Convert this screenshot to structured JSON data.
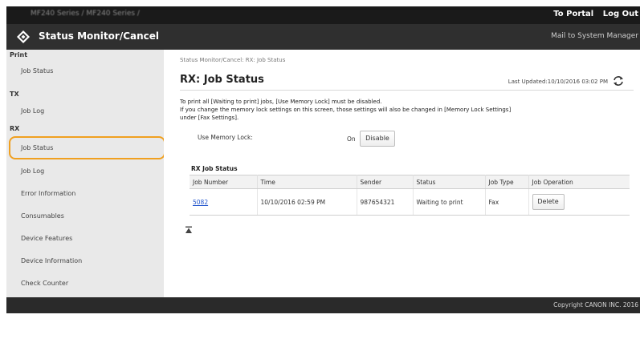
{
  "topbar": {
    "series": "MF240 Series / MF240 Series /",
    "to_portal": "To Portal",
    "logout": "Log Out"
  },
  "titlebar": {
    "title": "Status Monitor/Cancel",
    "mail": "Mail to System Manager"
  },
  "sidebar": {
    "print_section": "Print",
    "print_job_status": "Job Status",
    "tx_section": "TX",
    "tx_job_log": "Job Log",
    "rx_section": "RX",
    "rx_job_status": "Job Status",
    "rx_job_log": "Job Log",
    "error_information": "Error Information",
    "consumables": "Consumables",
    "device_features": "Device Features",
    "device_information": "Device Information",
    "check_counter": "Check Counter"
  },
  "main": {
    "breadcrumb": "Status Monitor/Cancel: RX: Job Status",
    "heading": "RX: Job Status",
    "last_updated": "Last Updated:10/10/2016 03:02 PM",
    "message_1": "To print all [Waiting to print] jobs, [Use Memory Lock] must be disabled.",
    "message_2": "If you change the memory lock settings on this screen, those settings will also be changed in [Memory Lock Settings]",
    "message_3": "under [Fax Settings].",
    "memory_lock_label": "Use Memory Lock:",
    "memory_lock_value": "On",
    "disable_label": "Disable",
    "rx_job_status_title": "RX Job Status",
    "columns": {
      "job_number": "Job Number",
      "time": "Time",
      "sender": "Sender",
      "status": "Status",
      "job_type": "Job Type",
      "job_operation": "Job Operation"
    },
    "row": {
      "job_number": "5082",
      "time": "10/10/2016 02:59 PM",
      "sender": "987654321",
      "status": "Waiting to print",
      "job_type": "Fax",
      "delete_label": "Delete"
    }
  },
  "footer": {
    "copyright": "Copyright CANON INC. 2016"
  },
  "colors": {
    "highlight": "#f0a020",
    "link": "#2255cc",
    "topbar": "#1a1a1a",
    "titlebar": "#2f2f2f",
    "sidebar": "#e9e9e9"
  },
  "icons": {
    "logo": "canon-diamond-icon",
    "refresh": "refresh-icon",
    "back_to_top": "back-to-top-icon"
  }
}
